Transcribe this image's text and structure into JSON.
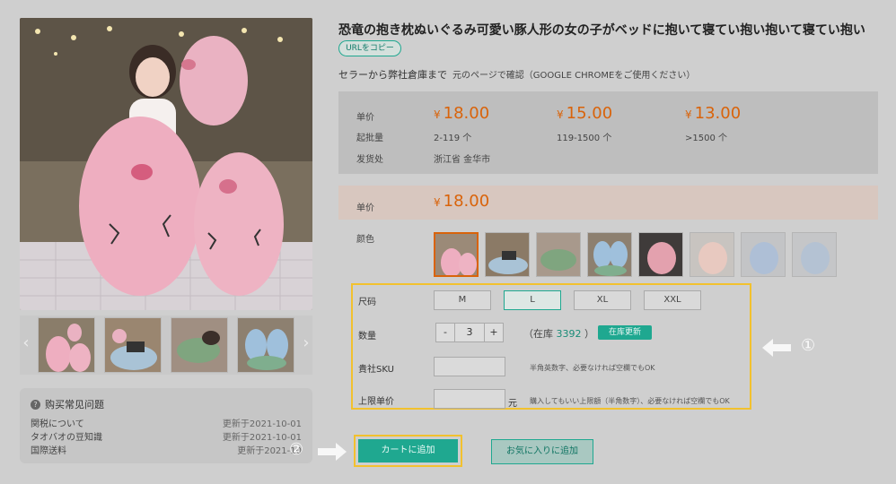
{
  "product": {
    "title": "恐竜の抱き枕ぬいぐるみ可愛い豚人形の女の子がベッドに抱いて寝てい抱い抱いて寝てい抱い",
    "url_copy_label": "URLをコピー",
    "warehouse_note": "セラーから弊社倉庫まで",
    "warehouse_note_small": "元のページで確認（GOOGLE CHROMEをご使用ください）"
  },
  "price_box": {
    "label_price": "单价",
    "label_moq": "起批量",
    "label_ship": "发货处",
    "currency": "¥",
    "tiers": [
      {
        "price": "18.00",
        "range": "2-119 个"
      },
      {
        "price": "15.00",
        "range": "119-1500 个"
      },
      {
        "price": "13.00",
        "range": ">1500 个"
      }
    ],
    "ship_from": "浙江省 金华市"
  },
  "unit_price": {
    "label": "单价",
    "currency": "¥",
    "value": "18.00"
  },
  "color": {
    "label": "颜色",
    "selected_index": 0,
    "count": 8
  },
  "size": {
    "label": "尺码",
    "options": [
      "M",
      "L",
      "XL",
      "XXL"
    ],
    "selected": "L"
  },
  "quantity": {
    "label": "数量",
    "minus": "-",
    "value": "3",
    "plus": "+",
    "stock_prefix": "（在库",
    "stock_num": "3392",
    "stock_suffix": "）",
    "refresh_label": "在库更新"
  },
  "sku": {
    "label": "貴社SKU",
    "hint": "半角英数字、必要なければ空欄でもOK"
  },
  "limit_price": {
    "label": "上限单价",
    "unit": "元",
    "hint": "購入してもいい上限額（半角数字）、必要なければ空欄でもOK"
  },
  "actions": {
    "cart": "カートに追加",
    "favorite": "お気に入りに追加"
  },
  "markers": {
    "one": "①",
    "two": "②"
  },
  "faq": {
    "heading": "购买常见问题",
    "items": [
      {
        "title": "関税について",
        "date": "更新于2021-10-01"
      },
      {
        "title": "タオバオの豆知識",
        "date": "更新于2021-10-01"
      },
      {
        "title": "国際送料",
        "date": "更新于2021-10"
      }
    ]
  },
  "gallery": {
    "prev": "‹",
    "next": "›"
  },
  "colors": {
    "accent": "#1fa890",
    "price": "#d9630a",
    "highlight": "#f2c12e"
  }
}
